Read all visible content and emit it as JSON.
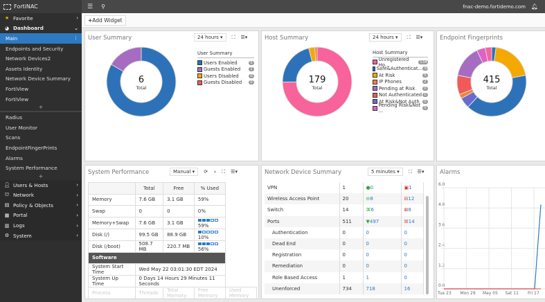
{
  "app": {
    "name": "FortiNAC",
    "host": "fnac-demo.fortidemo.com"
  },
  "sidebar": {
    "favorite": "Favorite",
    "dashboard": "Dashboard",
    "dash_items": [
      "Main",
      "Endpoints and Security",
      "Network Devices2",
      "Assets Identity",
      "Network Device Summary",
      "FortiView",
      "FortiView"
    ],
    "other_items": [
      "Radius",
      "User Monitor",
      "Scans",
      "EndpointFingerPrints",
      "Alarms",
      "System Performance"
    ],
    "sections": [
      "Users & Hosts",
      "Network",
      "Policy & Objects",
      "Portal",
      "Logs",
      "System"
    ]
  },
  "toolbar": {
    "add_widget": "Add Widget"
  },
  "user_summary": {
    "title": "User Summary",
    "range": "24 hours",
    "legend_title": "User Summary",
    "total": "6",
    "total_label": "Total",
    "items": [
      {
        "label": "Users Enabled",
        "value": 5,
        "color": "#2d72b8"
      },
      {
        "label": "Guests Enabled",
        "value": 1,
        "color": "#a56cc1"
      },
      {
        "label": "Users Disabled",
        "value": 0,
        "color": "#f5a800"
      },
      {
        "label": "Guests Disabled",
        "value": 0,
        "color": "#f05a5a"
      }
    ]
  },
  "host_summary": {
    "title": "Host Summary",
    "range": "24 hours",
    "legend_title": "Host Summary",
    "total": "179",
    "total_label": "Total",
    "items": [
      {
        "label": "Unregistered Ho...",
        "value": 134,
        "color": "#f7639a"
      },
      {
        "label": "Safe&Authenticat...",
        "value": 38,
        "color": "#2d72b8"
      },
      {
        "label": "At Risk",
        "value": 5,
        "color": "#f5a800"
      },
      {
        "label": "IP Phones",
        "value": 2,
        "color": "#f58231"
      },
      {
        "label": "Pending at Risk",
        "value": 0,
        "color": "#a56cc1"
      },
      {
        "label": "Not Authenticated",
        "value": 0,
        "color": "#f05a5a"
      },
      {
        "label": "At Risk&Not Auth",
        "value": 0,
        "color": "#6a6acf"
      },
      {
        "label": "Pending Risk&Not ...",
        "value": 0,
        "color": "#e060c8"
      }
    ]
  },
  "endpoint_fingerprints": {
    "title": "Endpoint Fingerprints",
    "total": "415",
    "total_label": "Total",
    "slices": [
      {
        "fraction": 0.02,
        "color": "#2d72b8"
      },
      {
        "fraction": 0.2,
        "color": "#f5a800"
      },
      {
        "fraction": 0.4,
        "color": "#2d72b8"
      },
      {
        "fraction": 0.05,
        "color": "#6a6acf"
      },
      {
        "fraction": 0.02,
        "color": "#f58231"
      },
      {
        "fraction": 0.09,
        "color": "#f05a5a"
      },
      {
        "fraction": 0.15,
        "color": "#a56cc1"
      },
      {
        "fraction": 0.04,
        "color": "#e060c8"
      },
      {
        "fraction": 0.03,
        "color": "#f7639a"
      }
    ]
  },
  "system_performance": {
    "title": "System Performance",
    "mode": "Manual",
    "headers": [
      "",
      "Total",
      "Free",
      "% Used"
    ],
    "rows": [
      {
        "name": "Memory",
        "total": "7.6 GB",
        "free": "3.1 GB",
        "used": "59%",
        "bar": null
      },
      {
        "name": "Swap",
        "total": "0",
        "free": "0",
        "used": "0%",
        "bar": null
      },
      {
        "name": "Memory+Swap",
        "total": "7.6 GB",
        "free": "3.1 GB",
        "used": "59%",
        "bar": 0.59
      },
      {
        "name": "Disk (/)",
        "total": "99.5 GB",
        "free": "88.9 GB",
        "used": "10%",
        "bar": 0.1
      },
      {
        "name": "Disk (/boot)",
        "total": "508.7 MB",
        "free": "220.7 MB",
        "used": "56%",
        "bar": 0.56
      }
    ],
    "software": "Software",
    "info": [
      {
        "label": "System Start Time",
        "value": "Wed May 22 03:01:30 EDT 2024"
      },
      {
        "label": "System Up Time",
        "value": "0 Days 14 Hours 29 Minutes 11 Seconds"
      }
    ],
    "proc_headers": [
      "Process",
      "Threads",
      "Total Memory",
      "Free Memory",
      "Used Memory"
    ]
  },
  "network_device_summary": {
    "title": "Network Device Summary",
    "range": "5 minutes",
    "rows": [
      {
        "name": "VPN",
        "total": "1",
        "up": "0",
        "down": "1",
        "indent": false
      },
      {
        "name": "Wireless Access Point",
        "total": "20",
        "up": "8",
        "down": "12",
        "indent": false
      },
      {
        "name": "Switch",
        "total": "14",
        "up": "6",
        "down": "8",
        "indent": false
      },
      {
        "name": "Ports",
        "total": "511",
        "up": "497",
        "down": "14",
        "indent": false
      },
      {
        "name": "Authentication",
        "total": "0",
        "up": "0",
        "down": "0",
        "indent": true
      },
      {
        "name": "Dead End",
        "total": "0",
        "up": "0",
        "down": "0",
        "indent": true
      },
      {
        "name": "Registration",
        "total": "0",
        "up": "0",
        "down": "0",
        "indent": true
      },
      {
        "name": "Remediation",
        "total": "0",
        "up": "0",
        "down": "0",
        "indent": true
      },
      {
        "name": "Role Based Access",
        "total": "1",
        "up": "1",
        "down": "0",
        "indent": true
      },
      {
        "name": "Unenforced",
        "total": "734",
        "up": "718",
        "down": "16",
        "indent": true
      }
    ]
  },
  "chart_data": {
    "type": "line",
    "title": "Alarms",
    "ylim": [
      0,
      6
    ],
    "yticks": [
      "6.0",
      "4.8",
      "3.6",
      "2.4",
      "1.2",
      "0.0"
    ],
    "categories": [
      "Tue 23",
      "Mon 29",
      "May 05",
      "Sat 11",
      "Fri 17"
    ],
    "series": [
      {
        "color": "#2d7ac2",
        "values": [
          0,
          0,
          0,
          0,
          0,
          5
        ]
      },
      {
        "color": "#f05a5a",
        "values": [
          0,
          0,
          0,
          0,
          0,
          0
        ]
      }
    ]
  }
}
